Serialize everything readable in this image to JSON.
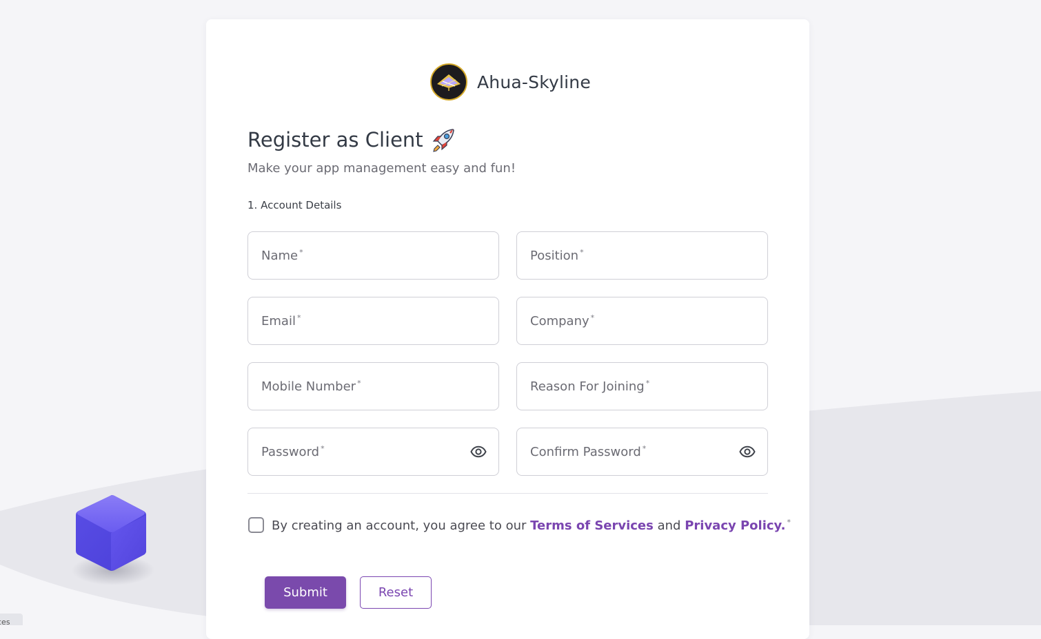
{
  "brand": {
    "name": "Ahua-Skyline",
    "logo_icon": "ahua-skyline-logo"
  },
  "header": {
    "title": "Register as Client",
    "title_icon": "rocket-icon",
    "subtitle": "Make your app management easy and fun!"
  },
  "form": {
    "section_label": "1. Account Details",
    "required_marker": "*",
    "fields": {
      "name": {
        "label": "Name"
      },
      "position": {
        "label": "Position"
      },
      "email": {
        "label": "Email"
      },
      "company": {
        "label": "Company"
      },
      "mobile": {
        "label": "Mobile Number"
      },
      "reason": {
        "label": "Reason For Joining"
      },
      "password": {
        "label": "Password",
        "icon": "eye-icon"
      },
      "confirm_password": {
        "label": "Confirm Password",
        "icon": "eye-icon"
      }
    },
    "terms": {
      "checked": false,
      "prefix": "By creating an account, you agree to our",
      "terms_link": "Terms of Services",
      "joiner": "and",
      "privacy_link": "Privacy Policy."
    },
    "buttons": {
      "submit": "Submit",
      "reset": "Reset"
    }
  },
  "corner_chip_text": "ces",
  "colors": {
    "accent": "#7a4aac",
    "link": "#7a45b0",
    "page_bg": "#f5f5f8",
    "card_bg": "#ffffff",
    "cube": "#5b4de0"
  }
}
